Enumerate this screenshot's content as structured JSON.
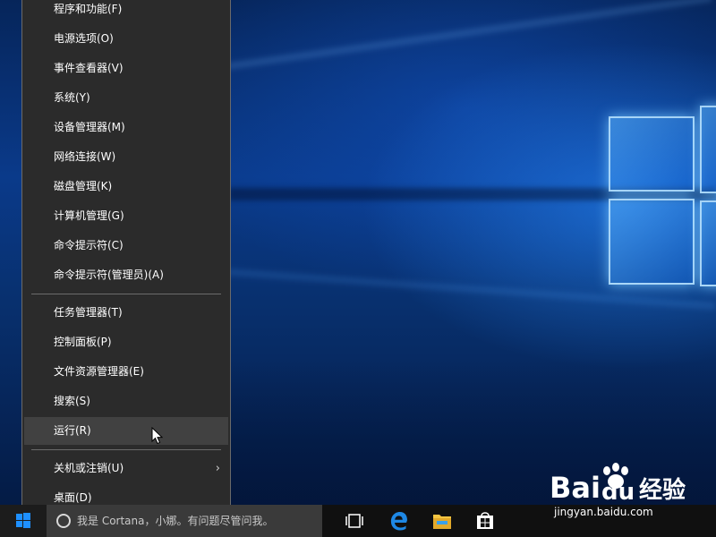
{
  "winx_menu": {
    "group1": [
      {
        "label": "程序和功能(F)"
      },
      {
        "label": "电源选项(O)"
      },
      {
        "label": "事件查看器(V)"
      },
      {
        "label": "系统(Y)"
      },
      {
        "label": "设备管理器(M)"
      },
      {
        "label": "网络连接(W)"
      },
      {
        "label": "磁盘管理(K)"
      },
      {
        "label": "计算机管理(G)"
      },
      {
        "label": "命令提示符(C)"
      },
      {
        "label": "命令提示符(管理员)(A)"
      }
    ],
    "group2": [
      {
        "label": "任务管理器(T)"
      },
      {
        "label": "控制面板(P)"
      },
      {
        "label": "文件资源管理器(E)"
      },
      {
        "label": "搜索(S)"
      },
      {
        "label": "运行(R)"
      }
    ],
    "group3": [
      {
        "label": "关机或注销(U)",
        "has_submenu": true
      },
      {
        "label": "桌面(D)"
      }
    ],
    "hovered_item": "运行(R)"
  },
  "taskbar": {
    "cortana_placeholder": "我是 Cortana，小娜。有问题尽管问我。",
    "pinned_icons": [
      "task-view-icon",
      "edge-icon",
      "file-explorer-icon",
      "store-icon"
    ]
  },
  "watermark": {
    "logo_text_1": "Bai",
    "logo_text_2": "du",
    "logo_text_3": "经验",
    "url": "jingyan.baidu.com"
  },
  "colors": {
    "menu_bg": "#2b2b2b",
    "menu_hover": "#414141",
    "taskbar_bg": "#101010",
    "start_blue": "#1e90ff",
    "edge_blue": "#1e88e5",
    "folder_yellow": "#f5c542"
  }
}
